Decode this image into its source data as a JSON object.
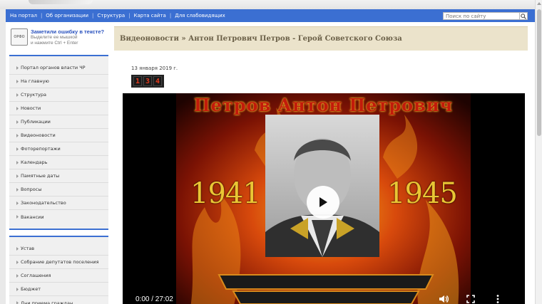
{
  "topnav": {
    "items": [
      "На портал",
      "Об организации",
      "Структура",
      "Карта сайта",
      "Для слабовидящих"
    ],
    "separator": "|"
  },
  "search": {
    "placeholder": "Поиск по сайту",
    "icon": "search-icon"
  },
  "orpho": {
    "icon_label": "ОРФО",
    "title": "Заметили ошибку в тексте?",
    "line1": "Выделите ее мышкой",
    "line2": "и нажмите Ctrl + Enter"
  },
  "sidebar": {
    "menu1": [
      "Портал органов власти ЧР",
      "На главную",
      "Структура",
      "Новости",
      "Публикации",
      "Видеоновости",
      "Фоторепортажи",
      "Календарь",
      "Памятные даты",
      "Вопросы",
      "Законодательство",
      "Вакансии"
    ],
    "menu2": [
      "Устав",
      "Собрание депутатов поселения",
      "Соглашения",
      "Бюджет",
      "Дни приема граждан"
    ]
  },
  "page": {
    "title": "Видеоновости » Антон Петрович Петров - Герой Советского Союза",
    "date": "13 января 2019 г.",
    "counter": [
      "1",
      "3",
      "4"
    ]
  },
  "video": {
    "frame_title": "Петров Антон Петрович",
    "year_left": "1941",
    "year_right": "1945",
    "time": "0:00 / 27:02",
    "progress": 0
  },
  "colors": {
    "nav": "#3b6fd2",
    "header_bg": "#ebe3cb",
    "counter_digit": "#e23a1e",
    "years": "#e9c634",
    "frame_title": "#c21b0b"
  }
}
